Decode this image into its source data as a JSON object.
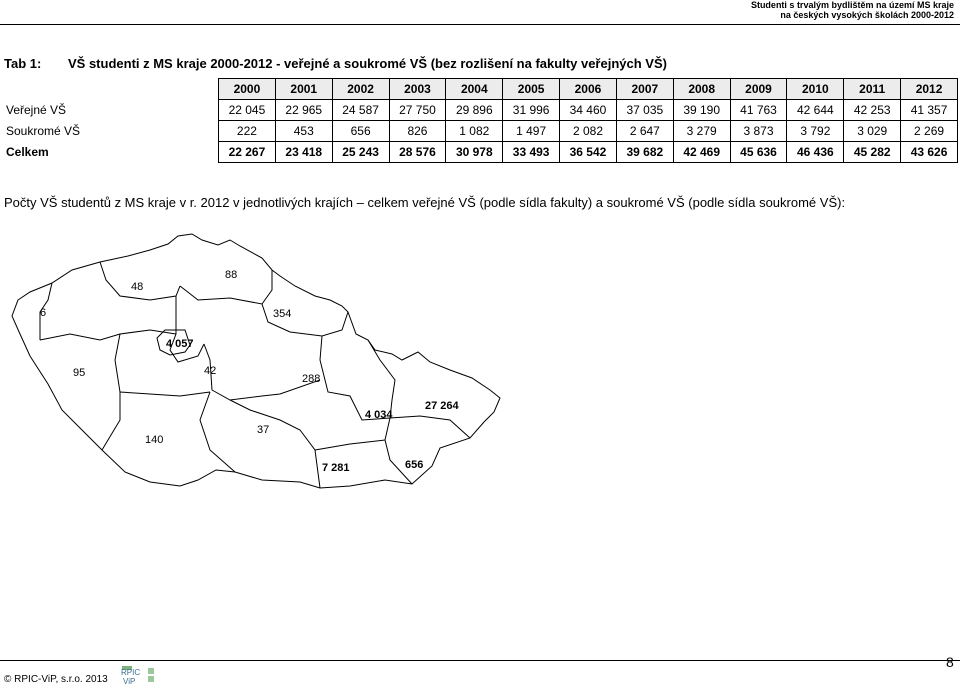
{
  "header": {
    "line1": "Studenti s trvalým bydlištěm na území MS kraje",
    "line2": "na českých vysokých školách 2000-2012"
  },
  "table": {
    "number": "Tab 1:",
    "title": "VŠ studenti z MS kraje 2000-2012 - veřejné a soukromé VŠ (bez rozlišení na fakulty veřejných VŠ)",
    "years": [
      "2000",
      "2001",
      "2002",
      "2003",
      "2004",
      "2005",
      "2006",
      "2007",
      "2008",
      "2009",
      "2010",
      "2011",
      "2012"
    ],
    "rows": [
      {
        "label": "Veřejné VŠ",
        "values": [
          "22 045",
          "22 965",
          "24 587",
          "27 750",
          "29 896",
          "31 996",
          "34 460",
          "37 035",
          "39 190",
          "41 763",
          "42 644",
          "42 253",
          "41 357"
        ]
      },
      {
        "label": "Soukromé VŠ",
        "values": [
          "222",
          "453",
          "656",
          "826",
          "1 082",
          "1 497",
          "2 082",
          "2 647",
          "3 279",
          "3 873",
          "3 792",
          "3 029",
          "2 269"
        ]
      },
      {
        "label": "Celkem",
        "values": [
          "22 267",
          "23 418",
          "25 243",
          "28 576",
          "30 978",
          "33 493",
          "36 542",
          "39 682",
          "42 469",
          "45 636",
          "46 436",
          "45 282",
          "43 626"
        ]
      }
    ]
  },
  "map": {
    "title": "Počty VŠ studentů z MS kraje v r. 2012 v jednotlivých krajích – celkem veřejné VŠ (podle sídla fakulty) a soukromé VŠ (podle sídla soukromé VŠ):",
    "labels": {
      "karlovarsky": "6",
      "ustecky": "48",
      "liberecky": "88",
      "kralovehradecky": "354",
      "praha": "4 057",
      "plzensky": "95",
      "stredocesky": "42",
      "pardubicky": "288",
      "olomoucky": "4 034",
      "moravskoslezsky": "27 264",
      "jihocesky": "140",
      "vysocina": "37",
      "jihomoravsky": "7 281",
      "zlinsky": "656"
    }
  },
  "footer": {
    "copyright": "© RPIC-ViP, s.r.o. 2013",
    "logo_text1": "RPIC",
    "logo_text2": "ViP",
    "page_number": "8"
  }
}
